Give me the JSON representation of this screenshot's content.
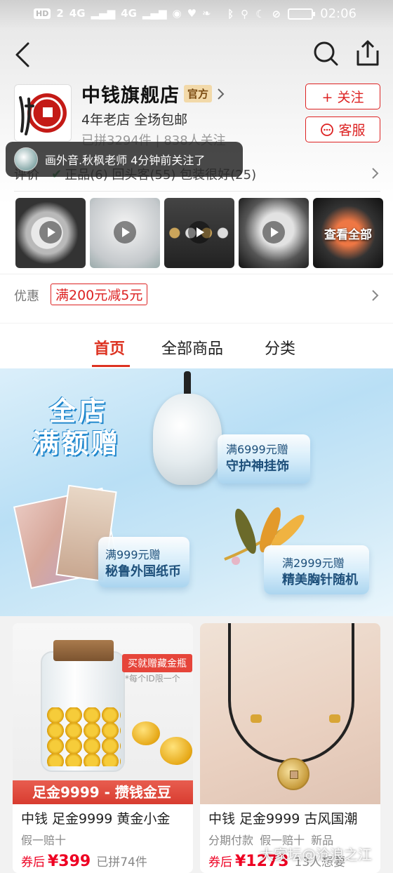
{
  "status_bar": {
    "hd_label": "HD",
    "sim": "2",
    "net1": "4G",
    "net2": "4G",
    "time": "02:06"
  },
  "store": {
    "name": "中钱旗舰店",
    "badge": "官方",
    "subtitle": "4年老店 全场包邮",
    "stats": "已拼3294件 | 838人关注",
    "follow_label": "+ 关注",
    "service_label": "客服"
  },
  "toast": {
    "text": "画外音.秋枫老师 4分钟前关注了"
  },
  "reviews": {
    "prefix": "评价",
    "text": "正品(6)  回头客(55)  包装很好(25)"
  },
  "videos": [
    {
      "icon": "play-icon"
    },
    {
      "icon": "play-icon"
    },
    {
      "icon": "play-icon"
    },
    {
      "icon": "play-icon"
    },
    {
      "label": "查看全部"
    }
  ],
  "promo": {
    "label": "优惠",
    "tag": "满200元减5元"
  },
  "tabs": [
    {
      "label": "首页",
      "active": true
    },
    {
      "label": "全部商品",
      "active": false
    },
    {
      "label": "分类",
      "active": false
    }
  ],
  "banner": {
    "title_line1": "全店",
    "title_line2": "满额赠",
    "gift1_line1": "满6999元赠",
    "gift1_line2": "守护神挂饰",
    "gift2_line1": "满999元赠",
    "gift2_line2": "秘鲁外国纸币",
    "gift3_line1": "满2999元赠",
    "gift3_line2": "精美胸针随机"
  },
  "products": [
    {
      "image_banner": "足金9999 - 攒钱金豆",
      "image_tag": "买就赠藏金瓶",
      "image_note": "*每个ID限一个",
      "title": "中钱 足金9999 黄金小金",
      "tags": "假一赔十",
      "price_prefix": "券后",
      "price": "¥399",
      "sold": "已拼74件"
    },
    {
      "title": "中钱 足金9999 古风国潮",
      "tags": "分期付款 假一赔十 新品",
      "price_prefix": "券后",
      "price": "¥1273",
      "sold": "13人想要"
    }
  ],
  "watermark": "大家坛@沧浪之江",
  "colors": {
    "accent": "#dd2222",
    "tab_active": "#dd3322",
    "price": "#ee0022"
  }
}
